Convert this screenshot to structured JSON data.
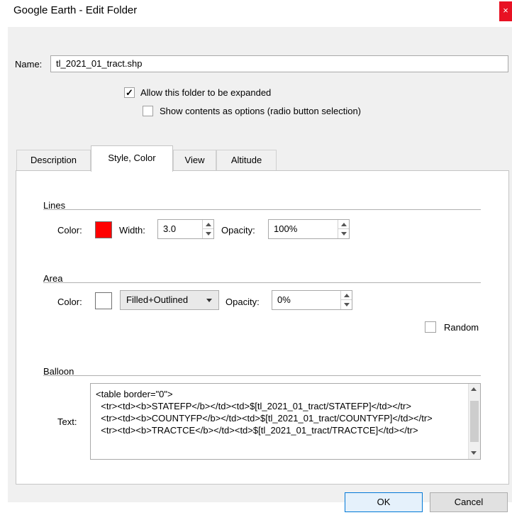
{
  "window": {
    "title": "Google Earth - Edit Folder",
    "close_glyph": "×"
  },
  "name": {
    "label": "Name:",
    "value": "tl_2021_01_tract.shp"
  },
  "options": {
    "allow_expand": {
      "label": "Allow this folder to be expanded",
      "checked": true
    },
    "radio_selection": {
      "label": "Show contents as options (radio button selection)",
      "checked": false
    }
  },
  "tabs": [
    {
      "label": "Description",
      "active": false
    },
    {
      "label": "Style, Color",
      "active": true
    },
    {
      "label": "View",
      "active": false
    },
    {
      "label": "Altitude",
      "active": false
    }
  ],
  "lines": {
    "group_label": "Lines",
    "color_label": "Color:",
    "color": "#ff0000",
    "width_label": "Width:",
    "width_value": "3.0",
    "opacity_label": "Opacity:",
    "opacity_value": "100%"
  },
  "area": {
    "group_label": "Area",
    "color_label": "Color:",
    "color": "#ffffff",
    "fill_mode": "Filled+Outlined",
    "opacity_label": "Opacity:",
    "opacity_value": "0%",
    "random_label": "Random",
    "random_checked": false
  },
  "balloon": {
    "group_label": "Balloon",
    "text_label": "Text:",
    "text": "<table border=\"0\">\n  <tr><td><b>STATEFP</b></td><td>$[tl_2021_01_tract/STATEFP]</td></tr>\n  <tr><td><b>COUNTYFP</b></td><td>$[tl_2021_01_tract/COUNTYFP]</td></tr>\n  <tr><td><b>TRACTCE</b></td><td>$[tl_2021_01_tract/TRACTCE]</td></tr>"
  },
  "buttons": {
    "ok": "OK",
    "cancel": "Cancel"
  }
}
